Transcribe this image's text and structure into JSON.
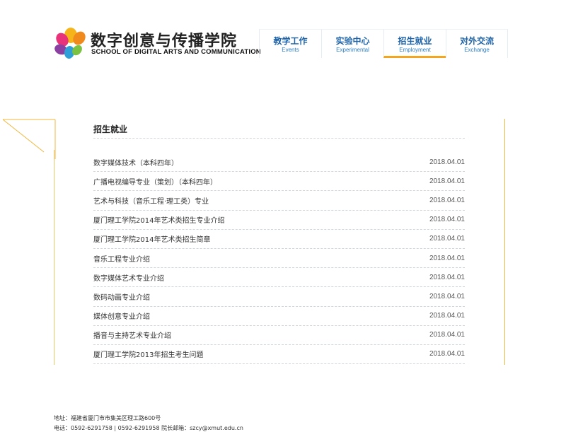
{
  "header": {
    "logo_cn": "数字创意与传播学院",
    "logo_en": "SCHOOL OF DIGITAL ARTS AND COMMUNICATION",
    "nav": [
      {
        "cn": "教学工作",
        "en": "Events"
      },
      {
        "cn": "实验中心",
        "en": "Experimental"
      },
      {
        "cn": "招生就业",
        "en": "Employment"
      },
      {
        "cn": "对外交流",
        "en": "Exchange"
      }
    ],
    "accent": "#f3a51f",
    "nav_color": "#1e63a8"
  },
  "section": {
    "title": "招生就业",
    "items": [
      {
        "title": "数字媒体技术（本科四年）",
        "date": "2018.04.01"
      },
      {
        "title": "广播电视编导专业（策划）（本科四年）",
        "date": "2018.04.01"
      },
      {
        "title": "艺术与科技（音乐工程·理工类）专业",
        "date": "2018.04.01"
      },
      {
        "title": "厦门理工学院2014年艺术类招生专业介绍",
        "date": "2018.04.01"
      },
      {
        "title": "厦门理工学院2014年艺术类招生简章",
        "date": "2018.04.01"
      },
      {
        "title": "音乐工程专业介绍",
        "date": "2018.04.01"
      },
      {
        "title": "数字媒体艺术专业介绍",
        "date": "2018.04.01"
      },
      {
        "title": "数码动画专业介绍",
        "date": "2018.04.01"
      },
      {
        "title": "媒体创意专业介绍",
        "date": "2018.04.01"
      },
      {
        "title": "播音与主持艺术专业介绍",
        "date": "2018.04.01"
      },
      {
        "title": "厦门理工学院2013年招生考生问题",
        "date": "2018.04.01"
      }
    ]
  },
  "footer": {
    "address": "地址：福建省厦门市市集美区理工路600号",
    "contact": "电话：0592-6291758 | 0592-6291958 院长邮箱：szcy@xmut.edu.cn"
  }
}
